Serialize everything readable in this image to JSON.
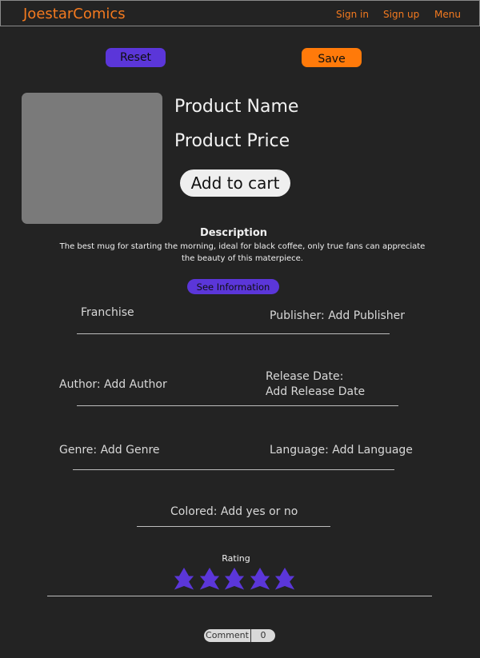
{
  "header": {
    "brand": "JoestarComics",
    "nav": {
      "sign_in": "Sign in",
      "sign_up": "Sign up",
      "menu": "Menu"
    }
  },
  "toolbar": {
    "reset_label": "Reset",
    "save_label": "Save"
  },
  "product": {
    "name": "Product Name",
    "price": "Product Price",
    "add_to_cart": "Add to cart"
  },
  "description": {
    "title": "Description",
    "text": "The best mug for starting the morning, ideal for black coffee, only true fans can appreciate the beauty of this materpiece."
  },
  "see_information_label": "See Information",
  "fields": {
    "franchise": "Franchise",
    "publisher": "Publisher: Add Publisher",
    "author": "Author: Add Author",
    "release_date_line1": "Release Date:",
    "release_date_line2": "Add Release Date",
    "genre": "Genre: Add Genre",
    "language": "Language: Add Language",
    "colored": "Colored: Add yes or no"
  },
  "rating": {
    "label": "Rating",
    "stars_filled": 5,
    "stars_total": 5
  },
  "comment": {
    "label": "Comment",
    "count": "0"
  },
  "colors": {
    "background": "#232323",
    "brand_orange": "#f47a1f",
    "save_orange": "#ff7a0a",
    "accent_purple": "#5b36d9",
    "star_purple": "#5b36d9",
    "image_placeholder": "#7a7a7a"
  }
}
